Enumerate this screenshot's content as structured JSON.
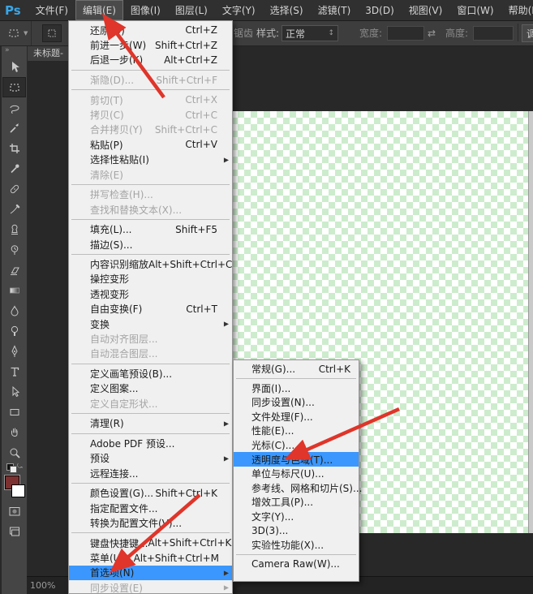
{
  "menubar": {
    "logo": "Ps",
    "items": [
      {
        "label": "文件(F)"
      },
      {
        "label": "编辑(E)"
      },
      {
        "label": "图像(I)"
      },
      {
        "label": "图层(L)"
      },
      {
        "label": "文字(Y)"
      },
      {
        "label": "选择(S)"
      },
      {
        "label": "滤镜(T)"
      },
      {
        "label": "3D(D)"
      },
      {
        "label": "视图(V)"
      },
      {
        "label": "窗口(W)"
      },
      {
        "label": "帮助(H)"
      }
    ]
  },
  "options_bar": {
    "antialias_fragment": "锯齿",
    "style_label": "样式:",
    "style_value": "正常",
    "width_label": "宽度:",
    "height_label": "高度:",
    "refine_edge_label": "调整边缘"
  },
  "icons": {
    "submenu_arrow": "▶",
    "dropdown_caret": "▼",
    "stepper": "↕",
    "link": "⇄",
    "collapse": "»",
    "swap": "⤿"
  },
  "document_tab": {
    "title": "未标题-"
  },
  "status_bar": {
    "zoom": "100%"
  },
  "toolbar": {
    "tools": [
      "move",
      "rectangular-marquee",
      "lasso",
      "quick-selection",
      "crop",
      "eyedropper",
      "spot-healing-brush",
      "brush",
      "clone-stamp",
      "history-brush",
      "eraser",
      "gradient",
      "blur",
      "dodge",
      "pen",
      "type",
      "path-selection",
      "rectangle-shape",
      "hand",
      "zoom"
    ],
    "selected_tool": "rectangular-marquee"
  },
  "edit_menu": {
    "title": "编辑(E)",
    "items": [
      {
        "label": "还原(O)",
        "shortcut": "Ctrl+Z"
      },
      {
        "label": "前进一步(W)",
        "shortcut": "Shift+Ctrl+Z"
      },
      {
        "label": "后退一步(K)",
        "shortcut": "Alt+Ctrl+Z"
      },
      {
        "label": "渐隐(D)...",
        "shortcut": "Shift+Ctrl+F",
        "disabled": true
      },
      {
        "label": "剪切(T)",
        "shortcut": "Ctrl+X",
        "disabled": true
      },
      {
        "label": "拷贝(C)",
        "shortcut": "Ctrl+C",
        "disabled": true
      },
      {
        "label": "合并拷贝(Y)",
        "shortcut": "Shift+Ctrl+C",
        "disabled": true
      },
      {
        "label": "粘贴(P)",
        "shortcut": "Ctrl+V"
      },
      {
        "label": "选择性粘贴(I)",
        "submenu": true
      },
      {
        "label": "清除(E)",
        "disabled": true
      },
      {
        "label": "拼写检查(H)...",
        "disabled": true
      },
      {
        "label": "查找和替换文本(X)...",
        "disabled": true
      },
      {
        "label": "填充(L)...",
        "shortcut": "Shift+F5"
      },
      {
        "label": "描边(S)..."
      },
      {
        "label": "内容识别缩放",
        "shortcut": "Alt+Shift+Ctrl+C"
      },
      {
        "label": "操控变形"
      },
      {
        "label": "透视变形"
      },
      {
        "label": "自由变换(F)",
        "shortcut": "Ctrl+T"
      },
      {
        "label": "变换",
        "submenu": true
      },
      {
        "label": "自动对齐图层...",
        "disabled": true
      },
      {
        "label": "自动混合图层...",
        "disabled": true
      },
      {
        "label": "定义画笔预设(B)..."
      },
      {
        "label": "定义图案..."
      },
      {
        "label": "定义自定形状...",
        "disabled": true
      },
      {
        "label": "清理(R)",
        "submenu": true
      },
      {
        "label": "Adobe PDF 预设..."
      },
      {
        "label": "预设",
        "submenu": true
      },
      {
        "label": "远程连接..."
      },
      {
        "label": "颜色设置(G)...",
        "shortcut": "Shift+Ctrl+K"
      },
      {
        "label": "指定配置文件..."
      },
      {
        "label": "转换为配置文件(V)..."
      },
      {
        "label": "键盘快捷键...",
        "shortcut": "Alt+Shift+Ctrl+K"
      },
      {
        "label": "菜单(U)...",
        "shortcut": "Alt+Shift+Ctrl+M"
      },
      {
        "label": "首选项(N)",
        "submenu": true,
        "highlighted": true
      },
      {
        "label": "同步设置(E)",
        "submenu": true,
        "disabled": true
      }
    ]
  },
  "preferences_submenu": {
    "items": [
      {
        "label": "常规(G)...",
        "shortcut": "Ctrl+K"
      },
      {
        "label": "界面(I)..."
      },
      {
        "label": "同步设置(N)..."
      },
      {
        "label": "文件处理(F)..."
      },
      {
        "label": "性能(E)..."
      },
      {
        "label": "光标(C)..."
      },
      {
        "label": "透明度与色域(T)...",
        "highlighted": true
      },
      {
        "label": "单位与标尺(U)..."
      },
      {
        "label": "参考线、网格和切片(S)..."
      },
      {
        "label": "增效工具(P)..."
      },
      {
        "label": "文字(Y)..."
      },
      {
        "label": "3D(3)..."
      },
      {
        "label": "实验性功能(X)..."
      },
      {
        "label": "Camera Raw(W)..."
      }
    ]
  },
  "colors": {
    "menu_highlight": "#3b97fd",
    "annotation_red": "#df352a",
    "canvas_checker_green": "#cdeccd",
    "foreground_swatch": "#7d3030"
  }
}
